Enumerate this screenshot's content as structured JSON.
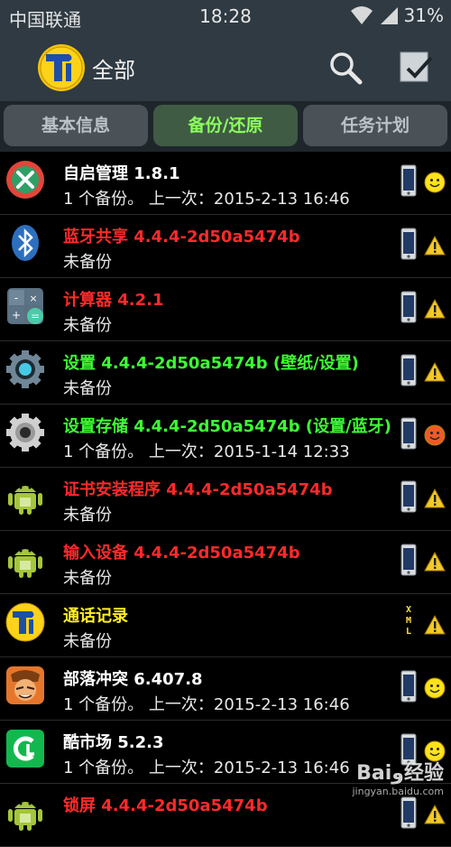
{
  "status_bar": {
    "carrier": "中国联通",
    "time": "18:28",
    "battery": "31%"
  },
  "header": {
    "title": "全部"
  },
  "tabs": [
    {
      "label": "基本信息",
      "active": false
    },
    {
      "label": "备份/还原",
      "active": true
    },
    {
      "label": "任务计划",
      "active": false
    }
  ],
  "apps": [
    {
      "name": "自启管理 1.8.1",
      "color": "white",
      "info": "1 个备份。  上一次：2015-2-13 16:46",
      "icon": "startup-manager-icon",
      "status": "smile"
    },
    {
      "name": "蓝牙共享 4.4.4-2d50a5474b",
      "color": "red",
      "info": "未备份",
      "icon": "bluetooth-icon",
      "status": "warning"
    },
    {
      "name": "计算器 4.2.1",
      "color": "red",
      "info": "未备份",
      "icon": "calculator-icon",
      "status": "warning"
    },
    {
      "name": "设置 4.4.4-2d50a5474b (壁纸/设置)",
      "color": "green",
      "info": "未备份",
      "icon": "settings-icon",
      "status": "warning"
    },
    {
      "name": "设置存储 4.4.4-2d50a5474b (设置/蓝牙)",
      "color": "green",
      "info": "1 个备份。  上一次：2015-1-14 12:33",
      "icon": "settings-storage-icon",
      "status": "smile-red"
    },
    {
      "name": "证书安装程序 4.4.4-2d50a5474b",
      "color": "red",
      "info": "未备份",
      "icon": "android-icon",
      "status": "warning"
    },
    {
      "name": "输入设备 4.4.4-2d50a5474b",
      "color": "red",
      "info": "未备份",
      "icon": "android-icon",
      "status": "warning"
    },
    {
      "name": "通话记录",
      "color": "yellow",
      "info": "未备份",
      "icon": "titanium-icon",
      "status": "warning",
      "store": "xml"
    },
    {
      "name": "部落冲突 6.407.8",
      "color": "white",
      "info": "1 个备份。  上一次：2015-2-13 16:46",
      "icon": "clash-of-clans-icon",
      "status": "smile"
    },
    {
      "name": "酷市场 5.2.3",
      "color": "white",
      "info": "1 个备份。  上一次：2015-2-13 16:46",
      "icon": "coolmarket-icon",
      "status": "smile"
    },
    {
      "name": "锁屏 4.4.4-2d50a5474b",
      "color": "red",
      "info": "",
      "icon": "android-icon",
      "status": "warning"
    }
  ],
  "watermark": {
    "brand": "Baiو经验",
    "url": "jingyan.baidu.com"
  }
}
